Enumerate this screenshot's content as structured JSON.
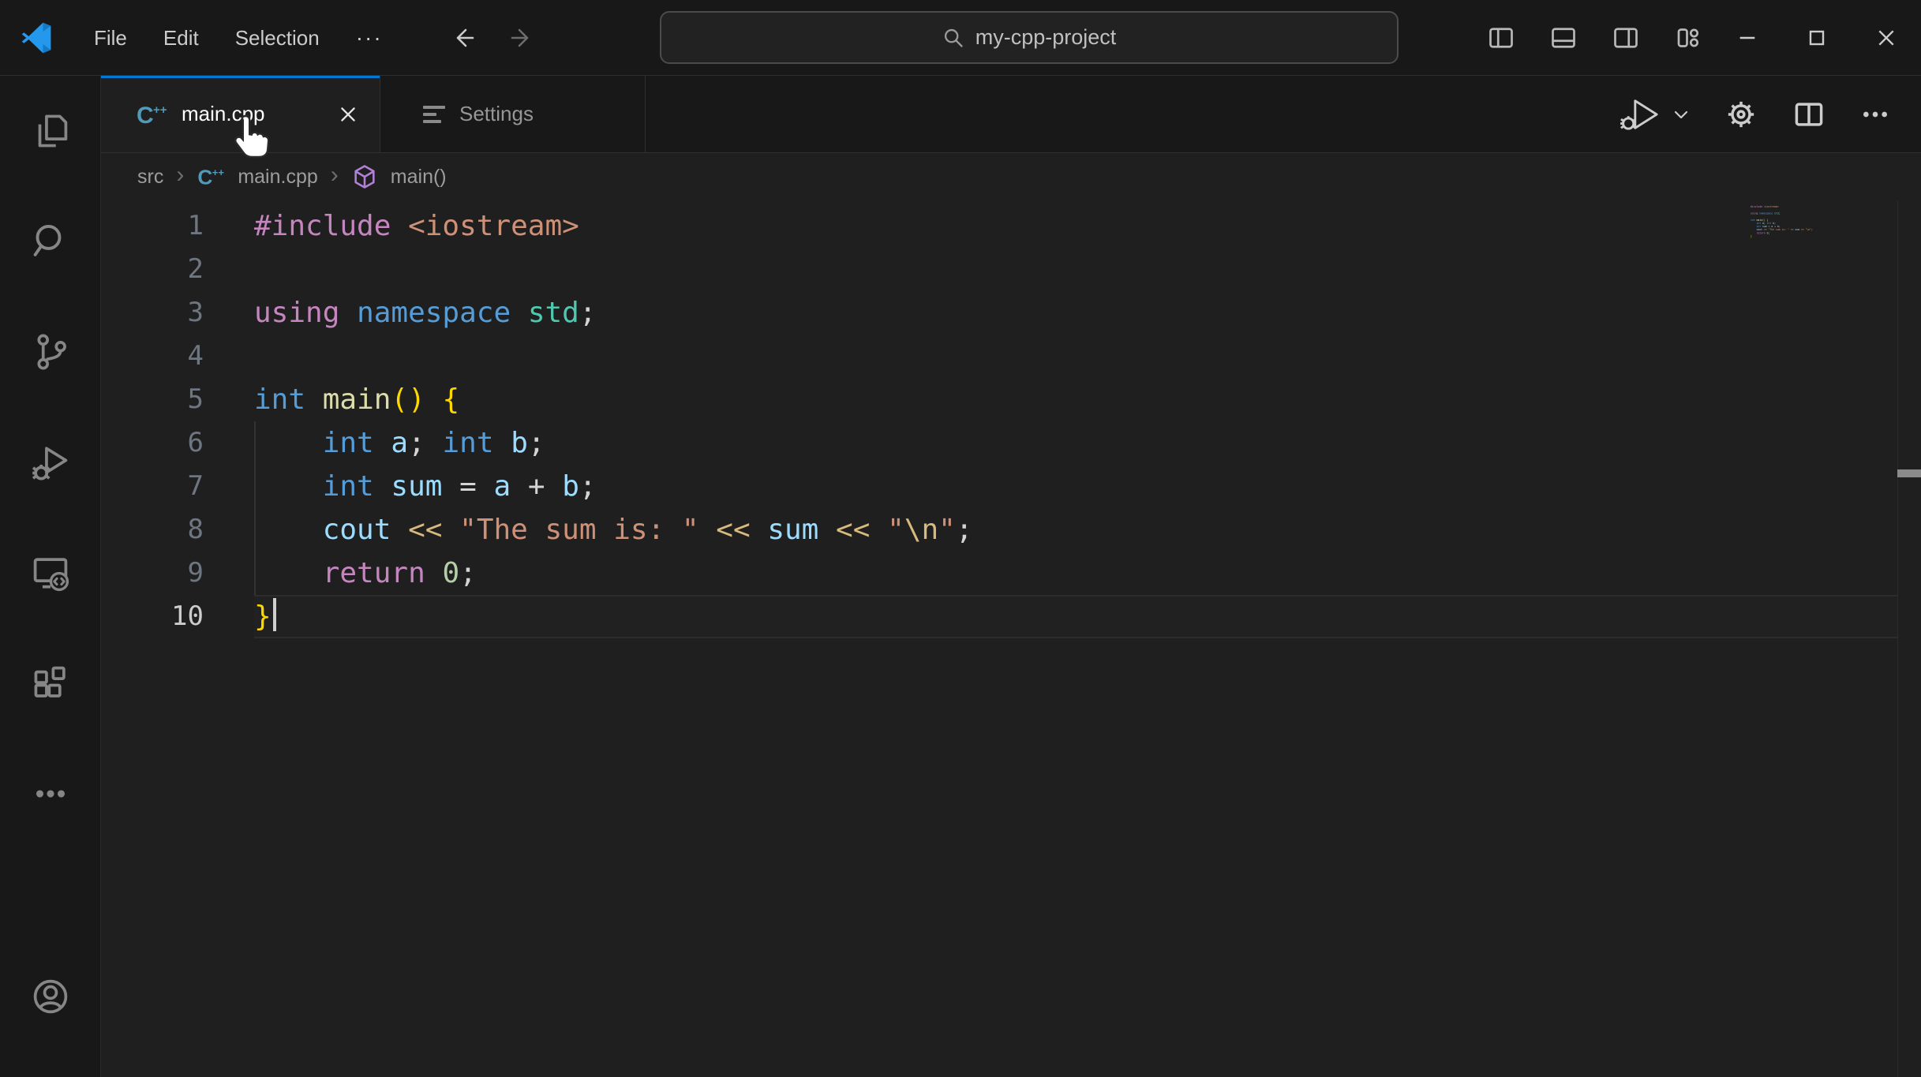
{
  "titlebar": {
    "menus": [
      "File",
      "Edit",
      "Selection"
    ],
    "more_label": "···",
    "search": {
      "value": "my-cpp-project"
    }
  },
  "tabs": [
    {
      "label": "main.cpp",
      "active": true
    },
    {
      "label": "Settings",
      "active": false
    }
  ],
  "editor_actions": [
    "run-or-debug",
    "open-settings",
    "split-editor",
    "more-actions"
  ],
  "activity_bar": {
    "items": [
      "explorer",
      "search",
      "source-control",
      "run-and-debug",
      "remote-explorer",
      "extensions",
      "more"
    ],
    "bottom_items": [
      "account"
    ]
  },
  "breadcrumb": {
    "items": [
      "src",
      "main.cpp",
      "main()"
    ],
    "separator": "›"
  },
  "ui_colors": {
    "titlebar_bg": "#181818",
    "editor_bg": "#1f1f1f",
    "accent_blue": "#0078d4",
    "cpp_icon_blue": "#519aba",
    "symbol_purple": "#b180d7",
    "logo_blue": "#2498ed",
    "line_number": "#6e7681",
    "line_number_active": "#cccccc"
  },
  "code": {
    "colors": {
      "pp": "#C586C0",
      "kw": "#569CD6",
      "type": "#4EC9B0",
      "fn": "#DCDCAA",
      "var": "#9CDCFE",
      "str": "#CE9178",
      "esc": "#D7BA7D",
      "op": "#D7BA7D",
      "num": "#B5CEA8",
      "pl": "#D4D4D4",
      "br": "#FFD700"
    },
    "lines": [
      {
        "n": "1",
        "tokens": [
          [
            "pp",
            "#include"
          ],
          [
            "pl",
            " "
          ],
          [
            "str",
            "<iostream>"
          ]
        ]
      },
      {
        "n": "2",
        "tokens": []
      },
      {
        "n": "3",
        "tokens": [
          [
            "pp",
            "using"
          ],
          [
            "pl",
            " "
          ],
          [
            "kw",
            "namespace"
          ],
          [
            "pl",
            " "
          ],
          [
            "type",
            "std"
          ],
          [
            "pl",
            ";"
          ]
        ]
      },
      {
        "n": "4",
        "tokens": []
      },
      {
        "n": "5",
        "tokens": [
          [
            "kw",
            "int"
          ],
          [
            "pl",
            " "
          ],
          [
            "fn",
            "main"
          ],
          [
            "br",
            "()"
          ],
          [
            "pl",
            " "
          ],
          [
            "br",
            "{"
          ]
        ]
      },
      {
        "n": "6",
        "tokens": [
          [
            "pl",
            "    "
          ],
          [
            "kw",
            "int"
          ],
          [
            "pl",
            " "
          ],
          [
            "var",
            "a"
          ],
          [
            "pl",
            "; "
          ],
          [
            "kw",
            "int"
          ],
          [
            "pl",
            " "
          ],
          [
            "var",
            "b"
          ],
          [
            "pl",
            ";"
          ]
        ]
      },
      {
        "n": "7",
        "tokens": [
          [
            "pl",
            "    "
          ],
          [
            "kw",
            "int"
          ],
          [
            "pl",
            " "
          ],
          [
            "var",
            "sum"
          ],
          [
            "pl",
            " = "
          ],
          [
            "var",
            "a"
          ],
          [
            "pl",
            " + "
          ],
          [
            "var",
            "b"
          ],
          [
            "pl",
            ";"
          ]
        ]
      },
      {
        "n": "8",
        "tokens": [
          [
            "pl",
            "    "
          ],
          [
            "var",
            "cout"
          ],
          [
            "pl",
            " "
          ],
          [
            "op",
            "<<"
          ],
          [
            "pl",
            " "
          ],
          [
            "str",
            "\"The sum is: \""
          ],
          [
            "pl",
            " "
          ],
          [
            "op",
            "<<"
          ],
          [
            "pl",
            " "
          ],
          [
            "var",
            "sum"
          ],
          [
            "pl",
            " "
          ],
          [
            "op",
            "<<"
          ],
          [
            "pl",
            " "
          ],
          [
            "str",
            "\""
          ],
          [
            "esc",
            "\\n"
          ],
          [
            "str",
            "\""
          ],
          [
            "pl",
            ";"
          ]
        ]
      },
      {
        "n": "9",
        "tokens": [
          [
            "pl",
            "    "
          ],
          [
            "pp",
            "return"
          ],
          [
            "pl",
            " "
          ],
          [
            "num",
            "0"
          ],
          [
            "pl",
            ";"
          ]
        ]
      },
      {
        "n": "10",
        "tokens": [
          [
            "br",
            "}"
          ]
        ],
        "current": true,
        "cursor": true
      }
    ]
  }
}
